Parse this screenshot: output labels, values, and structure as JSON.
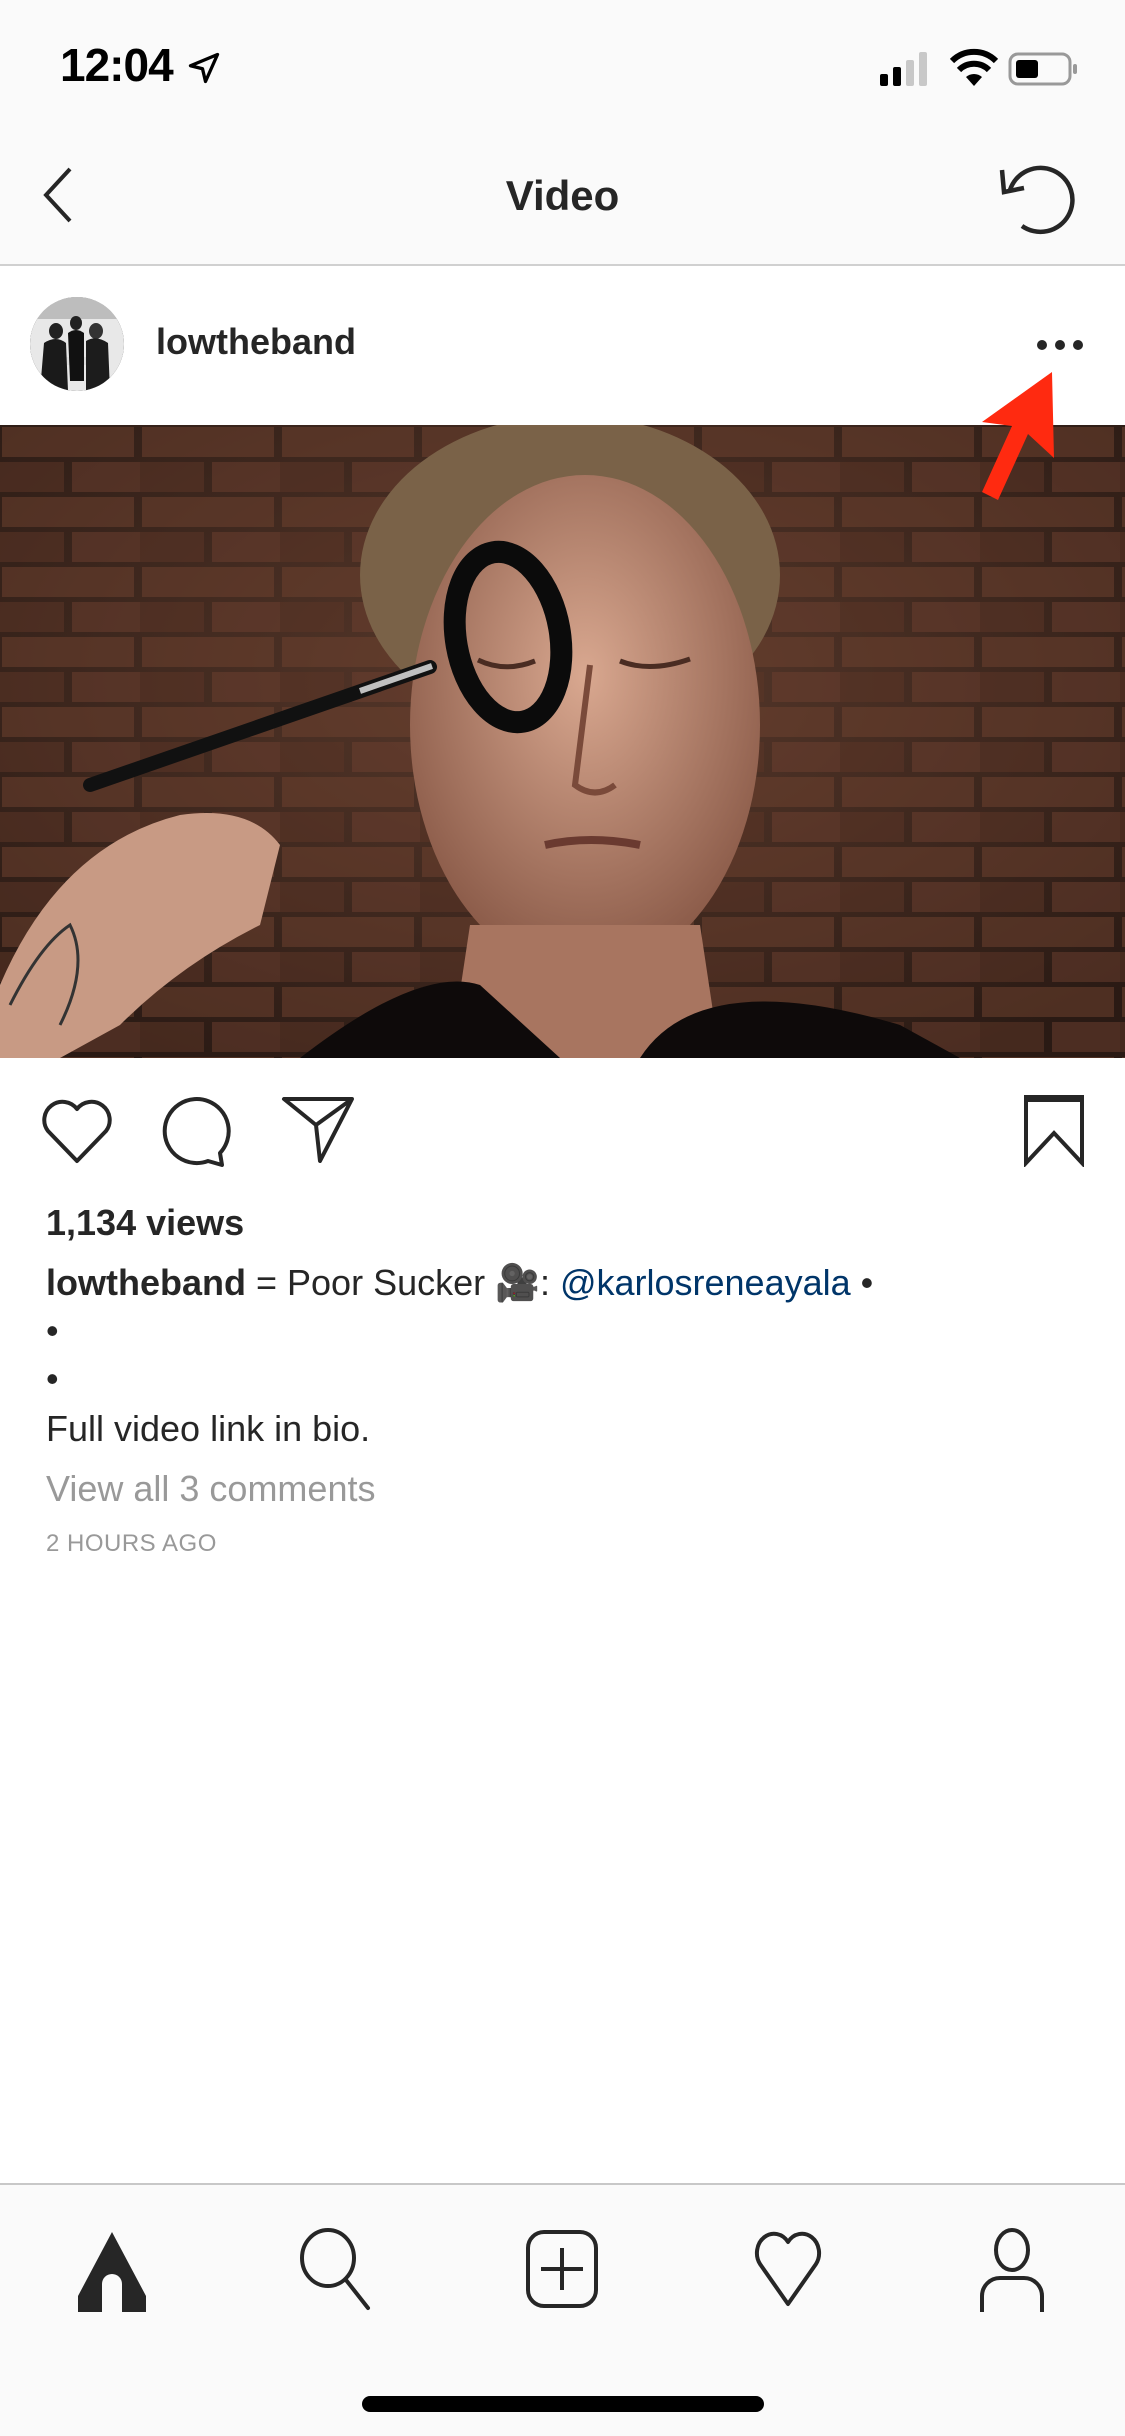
{
  "status_bar": {
    "time": "12:04",
    "icons": [
      "location-arrow-icon",
      "cellular-signal-icon",
      "wifi-icon",
      "battery-icon"
    ]
  },
  "nav": {
    "title": "Video",
    "left_icon": "back-chevron-icon",
    "right_icon": "refresh-icon"
  },
  "post": {
    "username": "lowtheband",
    "more_icon": "more-options-icon",
    "media_description": "Video frame: man with eyes closed having a black ring painted around his eye with a brush, brick wall background",
    "annotation": "red arrow pointing to more options button",
    "actions": {
      "like_icon": "heart-icon",
      "comment_icon": "comment-icon",
      "share_icon": "paper-plane-icon",
      "save_icon": "bookmark-icon"
    },
    "views": "1,134 views",
    "caption": {
      "username": "lowtheband",
      "text": " = Poor Sucker 🎥: ",
      "mention": "@karlosreneayala",
      "trailing": " •",
      "bullet1": "•",
      "bullet2": "•",
      "line": "Full video link in bio."
    },
    "view_comments": "View all 3 comments",
    "timestamp": "2 HOURS AGO"
  },
  "tab_bar": {
    "items": [
      {
        "name": "home",
        "icon": "home-icon",
        "active": true
      },
      {
        "name": "search",
        "icon": "search-icon",
        "active": false
      },
      {
        "name": "new-post",
        "icon": "add-post-icon",
        "active": false
      },
      {
        "name": "activity",
        "icon": "heart-icon",
        "active": false
      },
      {
        "name": "profile",
        "icon": "profile-icon",
        "active": false
      }
    ]
  },
  "colors": {
    "mention": "#003569",
    "arrow": "#ff2a10",
    "secondary_text": "#999999"
  }
}
